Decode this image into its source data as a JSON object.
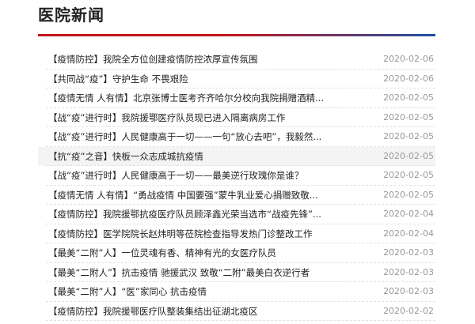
{
  "section": {
    "title": "医院新闻"
  },
  "news": [
    {
      "title": "【疫情防控】我院全方位创建疫情防控浓厚宣传氛围",
      "date": "2020-02-06"
    },
    {
      "title": "【共同战“疫”】守护生命 不畏艰险",
      "date": "2020-02-06"
    },
    {
      "title": "【疫情无情 人有情】北京张博士医考齐齐哈尔分校向我院捐赠酒精...",
      "date": "2020-02-05"
    },
    {
      "title": "【战“疫”进行时】我院援鄂医疗队员现已进入隔离病房工作",
      "date": "2020-02-05"
    },
    {
      "title": "【战“疫”进行时】人民健康高于一切——一句“放心去吧”，我毅然...",
      "date": "2020-02-05"
    },
    {
      "title": "【抗“疫”之音】快板一众志成城抗疫情",
      "date": "2020-02-05"
    },
    {
      "title": "【战“疫”进行时】人民健康高于一切——最美逆行玫瑰你是谁？",
      "date": "2020-02-05"
    },
    {
      "title": "【疫情无情 人有情】“勇战疫情 中国要强”蒙牛乳业爱心捐赠致敬...",
      "date": "2020-02-05"
    },
    {
      "title": "【疫情防控】我院援鄂抗疫医疗队员顾泽鑫光荣当选市“战疫先锋”...",
      "date": "2020-02-04"
    },
    {
      "title": "【疫情防控】医学院院长赵炜明等莅院检查指导发热门诊整改工作",
      "date": "2020-02-04"
    },
    {
      "title": "【最美“二附”人】一位灵魂有香、精神有光的女医疗队员",
      "date": "2020-02-03"
    },
    {
      "title": "【最美“二附人”】抗击疫情 驰援武汉 致敬“二附”最美白衣逆行者",
      "date": "2020-02-03"
    },
    {
      "title": "【最美“二附”人】“医”家同心 抗击疫情",
      "date": "2020-02-03"
    },
    {
      "title": "【疫情防控】我院援鄂医疗队整装集结出征湖北疫区",
      "date": "2020-02-02"
    }
  ]
}
